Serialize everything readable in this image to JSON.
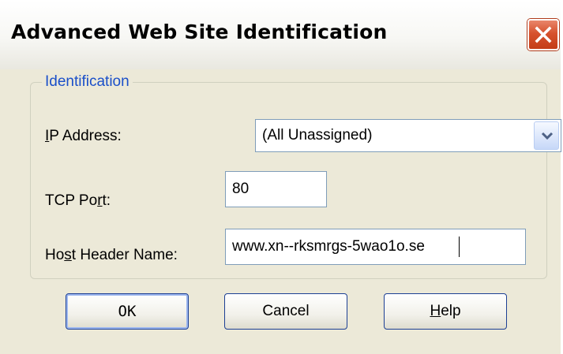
{
  "dialog": {
    "title": "Advanced Web Site Identification"
  },
  "group": {
    "legend": "Identification"
  },
  "fields": {
    "ip_address": {
      "label_prefix": "",
      "label_mnemonic": "I",
      "label_suffix": "P Address:",
      "value": "(All Unassigned)"
    },
    "tcp_port": {
      "label_prefix": "TCP Po",
      "label_mnemonic": "r",
      "label_suffix": "t:",
      "value": "80"
    },
    "host_header": {
      "label_prefix": "Ho",
      "label_mnemonic": "s",
      "label_suffix": "t Header Name:",
      "value": "www.xn--rksmrgs-5wao1o.se"
    }
  },
  "buttons": {
    "ok": "OK",
    "cancel": "Cancel",
    "help_mnemonic": "H",
    "help_suffix": "elp"
  },
  "icons": {
    "close": "close-icon",
    "dropdown": "chevron-down-icon"
  },
  "colors": {
    "dialog_bg": "#ece9d8",
    "group_legend": "#1a4fc9",
    "close_button": "#d6522e",
    "field_border": "#7f9db9"
  }
}
